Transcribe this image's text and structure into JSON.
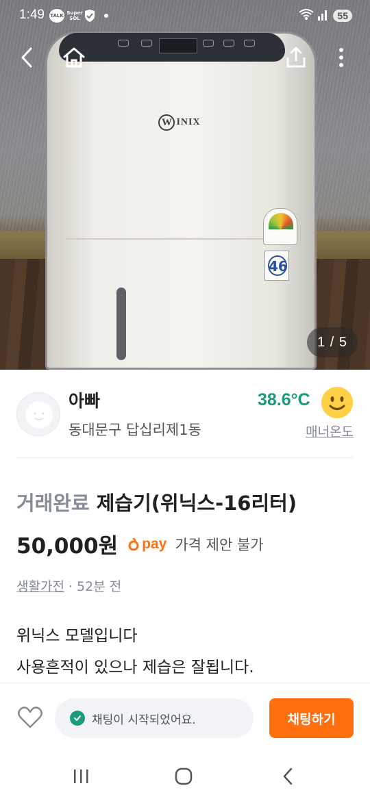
{
  "status_bar": {
    "time": "1:49",
    "talk_label": "TALK",
    "super_label": "Super SOL",
    "battery": "55",
    "icons": [
      "kakaotalk-icon",
      "super-sol-icon",
      "check-shield-icon",
      "notification-dot",
      "wifi-icon",
      "signal-icon",
      "battery-icon"
    ]
  },
  "photo": {
    "counter": "1 / 5",
    "brand_text": "INIX",
    "brand_letter": "W",
    "sticker_number": "46",
    "nav_icons": [
      "back-icon",
      "home-icon",
      "share-icon",
      "more-icon"
    ]
  },
  "seller": {
    "name": "아빠",
    "location": "동대문구 답십리제1동",
    "temperature": "38.6°C",
    "manner_label": "매너온도"
  },
  "post": {
    "status": "거래완료",
    "title": "제습기(위닉스-16리터)",
    "price": "50,000원",
    "pay_label": "pay",
    "negotiation": "가격 제안 불가",
    "category": "생활가전",
    "time_ago": " · 52분 전",
    "description_line1": "위닉스 모델입니다",
    "description_line2": "사용흔적이 있으나 제습은 잘됩니다."
  },
  "bottom_bar": {
    "chat_status": "채팅이 시작되었어요.",
    "chat_button": "채팅하기"
  },
  "colors": {
    "accent": "#ff6f0f",
    "temperature": "#1a9b7b",
    "muted": "#868b94"
  }
}
